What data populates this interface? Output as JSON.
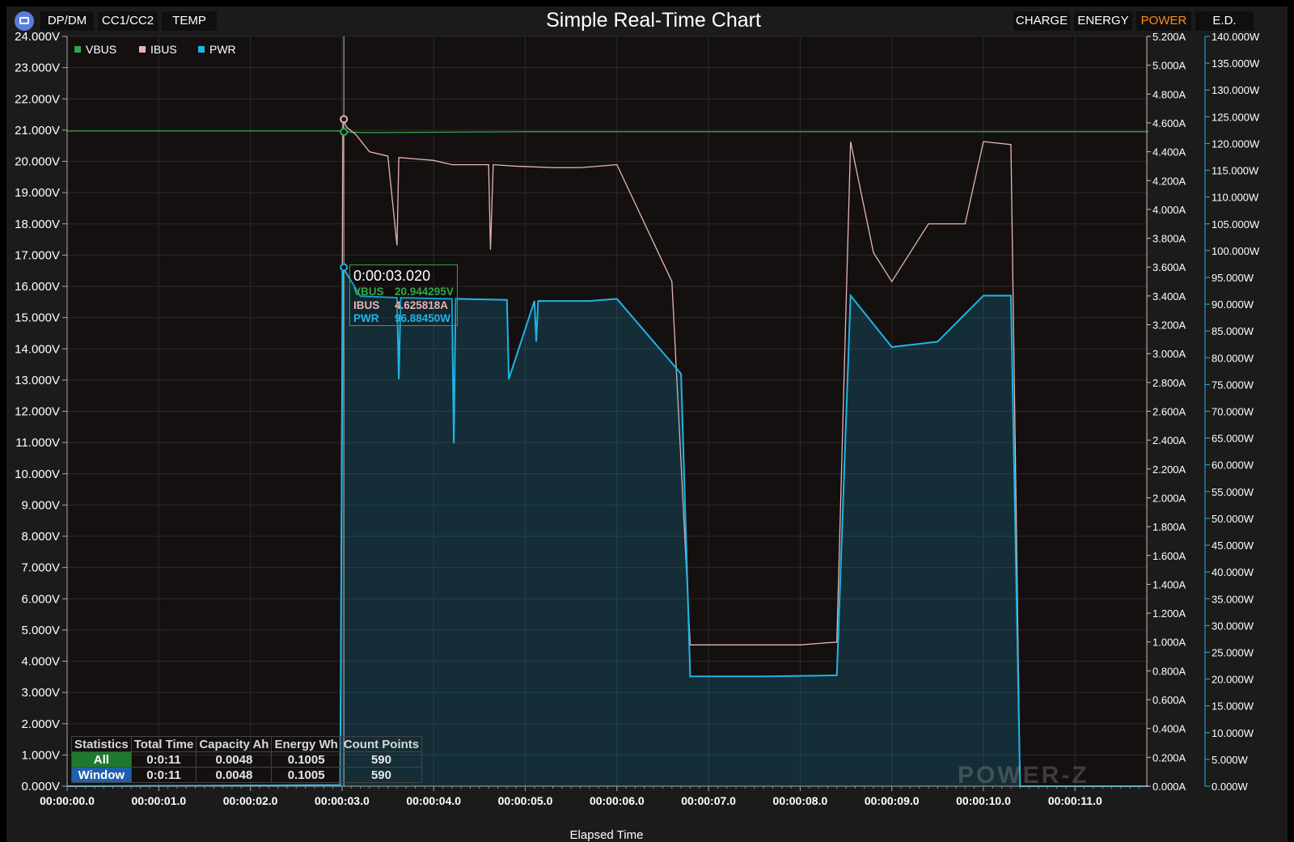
{
  "toolbar": {
    "left_tabs": [
      {
        "label": "DP/DM"
      },
      {
        "label": "CC1/CC2"
      },
      {
        "label": "TEMP"
      }
    ],
    "right_tabs": [
      {
        "label": "CHARGE"
      },
      {
        "label": "ENERGY"
      },
      {
        "label": "POWER",
        "active": true
      },
      {
        "label": "E.D."
      }
    ],
    "active_color": "#ff8c1a"
  },
  "chart_data": {
    "type": "line",
    "title": "Simple Real-Time Chart",
    "xlabel": "Elapsed Time",
    "x_ticks": [
      "00:00:00.0",
      "00:00:01.0",
      "00:00:02.0",
      "00:00:03.0",
      "00:00:04.0",
      "00:00:05.0",
      "00:00:06.0",
      "00:00:07.0",
      "00:00:08.0",
      "00:00:09.0",
      "00:00:10.0",
      "00:00:11.0"
    ],
    "xlim": [
      0,
      11.8
    ],
    "axes": {
      "left": {
        "unit": "V",
        "min": 0,
        "max": 24,
        "ticks": [
          "0.000V",
          "1.000V",
          "2.000V",
          "3.000V",
          "4.000V",
          "5.000V",
          "6.000V",
          "7.000V",
          "8.000V",
          "9.000V",
          "10.000V",
          "11.000V",
          "12.000V",
          "13.000V",
          "14.000V",
          "15.000V",
          "16.000V",
          "17.000V",
          "18.000V",
          "19.000V",
          "20.000V",
          "21.000V",
          "22.000V",
          "23.000V",
          "24.000V"
        ]
      },
      "right1": {
        "unit": "A",
        "min": 0,
        "max": 5.2,
        "ticks": [
          "0.000A",
          "0.200A",
          "0.400A",
          "0.600A",
          "0.800A",
          "1.000A",
          "1.200A",
          "1.400A",
          "1.600A",
          "1.800A",
          "2.000A",
          "2.200A",
          "2.400A",
          "2.600A",
          "2.800A",
          "3.000A",
          "3.200A",
          "3.400A",
          "3.600A",
          "3.800A",
          "4.000A",
          "4.200A",
          "4.400A",
          "4.600A",
          "4.800A",
          "5.000A",
          "5.200A"
        ]
      },
      "right2": {
        "unit": "W",
        "min": 0,
        "max": 140,
        "ticks": [
          "0.000W",
          "5.000W",
          "10.000W",
          "15.000W",
          "20.000W",
          "25.000W",
          "30.000W",
          "35.000W",
          "40.000W",
          "45.000W",
          "50.000W",
          "55.000W",
          "60.000W",
          "65.000W",
          "70.000W",
          "75.000W",
          "80.000W",
          "85.000W",
          "90.000W",
          "95.000W",
          "100.000W",
          "105.000W",
          "110.000W",
          "115.000W",
          "120.000W",
          "125.000W",
          "130.000W",
          "135.000W",
          "140.000W"
        ]
      }
    },
    "grid": true,
    "legend_position": "top-left",
    "series": [
      {
        "name": "VBUS",
        "color": "#2ea84a",
        "axis": "left",
        "values": [
          [
            0,
            20.97
          ],
          [
            3.0,
            20.97
          ],
          [
            3.05,
            20.94
          ],
          [
            3.3,
            20.92
          ],
          [
            5.0,
            20.95
          ],
          [
            8.0,
            20.95
          ],
          [
            11.8,
            20.95
          ]
        ]
      },
      {
        "name": "IBUS",
        "color": "#e8b4b4",
        "axis": "right1",
        "values": [
          [
            0,
            0
          ],
          [
            2.98,
            0.01
          ],
          [
            3.01,
            4.63
          ],
          [
            3.05,
            4.57
          ],
          [
            3.15,
            4.52
          ],
          [
            3.3,
            4.4
          ],
          [
            3.5,
            4.37
          ],
          [
            3.6,
            3.75
          ],
          [
            3.62,
            4.36
          ],
          [
            4.0,
            4.34
          ],
          [
            4.2,
            4.31
          ],
          [
            4.6,
            4.31
          ],
          [
            4.62,
            3.72
          ],
          [
            4.65,
            4.31
          ],
          [
            4.9,
            4.3
          ],
          [
            5.3,
            4.29
          ],
          [
            5.6,
            4.29
          ],
          [
            6.0,
            4.31
          ],
          [
            6.6,
            3.5
          ],
          [
            6.8,
            0.98
          ],
          [
            7.5,
            0.98
          ],
          [
            8.0,
            0.98
          ],
          [
            8.4,
            1.0
          ],
          [
            8.55,
            4.47
          ],
          [
            8.8,
            3.7
          ],
          [
            9.0,
            3.5
          ],
          [
            9.4,
            3.9
          ],
          [
            9.8,
            3.9
          ],
          [
            10.0,
            4.47
          ],
          [
            10.3,
            4.45
          ],
          [
            10.4,
            0
          ]
        ]
      },
      {
        "name": "PWR",
        "color": "#1eb4e6",
        "axis": "right2",
        "fill": true,
        "values": [
          [
            0,
            0
          ],
          [
            2.98,
            0.2
          ],
          [
            3.01,
            96.88
          ],
          [
            3.2,
            91.5
          ],
          [
            3.6,
            91.2
          ],
          [
            3.62,
            76.0
          ],
          [
            3.64,
            91.2
          ],
          [
            4.2,
            91.0
          ],
          [
            4.22,
            64.0
          ],
          [
            4.24,
            91.0
          ],
          [
            4.8,
            90.8
          ],
          [
            4.82,
            76.0
          ],
          [
            5.1,
            90.6
          ],
          [
            5.12,
            83.0
          ],
          [
            5.14,
            90.6
          ],
          [
            5.7,
            90.6
          ],
          [
            6.0,
            91.0
          ],
          [
            6.7,
            77.0
          ],
          [
            6.8,
            20.5
          ],
          [
            7.6,
            20.5
          ],
          [
            8.4,
            20.7
          ],
          [
            8.55,
            91.6
          ],
          [
            9.0,
            82.0
          ],
          [
            9.5,
            83.0
          ],
          [
            10.0,
            91.6
          ],
          [
            10.3,
            91.6
          ],
          [
            10.4,
            0
          ],
          [
            11.8,
            0
          ]
        ]
      }
    ],
    "cursor": {
      "time": "0:00:03.020",
      "rows": [
        {
          "label": "VBUS",
          "value": "20.944295V",
          "color": "#2ea84a"
        },
        {
          "label": "IBUS",
          "value": "4.625818A",
          "color": "#e8b4b4"
        },
        {
          "label": "PWR",
          "value": "96.88450W",
          "color": "#1eb4e6"
        }
      ]
    }
  },
  "stats": {
    "headers": [
      "Statistics",
      "Total Time",
      "Capacity Ah",
      "Energy Wh",
      "Count Points"
    ],
    "rows": [
      {
        "label": "All",
        "color": "#1e7a2e",
        "values": [
          "0:0:11",
          "0.0048",
          "0.1005",
          "590"
        ]
      },
      {
        "label": "Window",
        "color": "#1f5fae",
        "values": [
          "0:0:11",
          "0.0048",
          "0.1005",
          "590"
        ]
      }
    ]
  },
  "watermark": "POWER-Z"
}
